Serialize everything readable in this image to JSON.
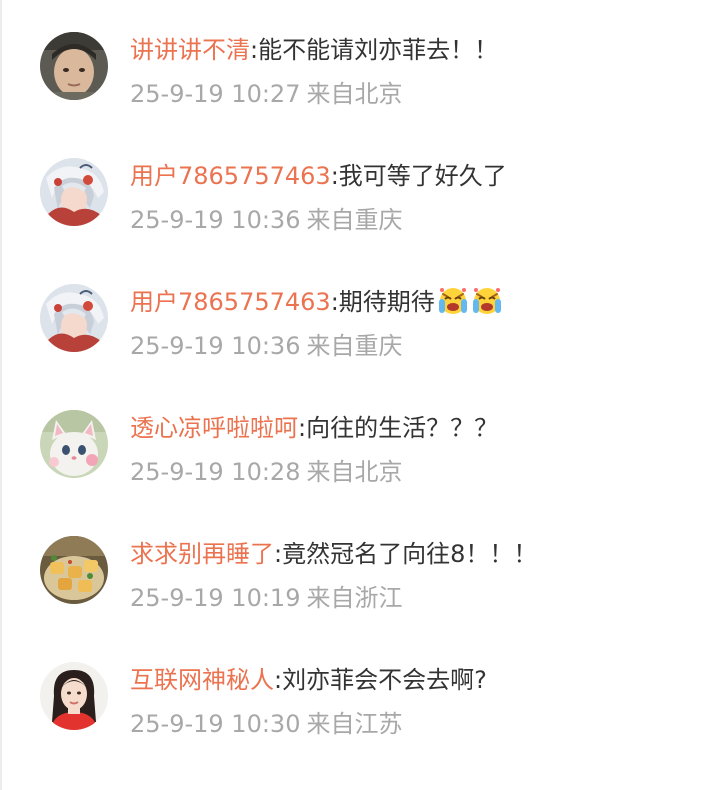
{
  "comments": [
    {
      "username": "讲讲讲不清",
      "separator": ":",
      "text": "能不能请刘亦菲去！！",
      "time": "25-9-19 10:27",
      "location": "来自北京",
      "avatar": "child-photo-avatar"
    },
    {
      "username": "用户7865757463",
      "separator": ":",
      "text": "我可等了好久了",
      "time": "25-9-19 10:36",
      "location": "来自重庆",
      "avatar": "anime-girl-avatar"
    },
    {
      "username": "用户7865757463",
      "separator": ":",
      "text": "期待期待",
      "time": "25-9-19 10:36",
      "location": "来自重庆",
      "avatar": "anime-girl-avatar",
      "emojis": [
        "crying-face-emoji",
        "crying-face-emoji"
      ]
    },
    {
      "username": "透心凉呼啦啦呵",
      "separator": ":",
      "text": "向往的生活？？？",
      "time": "25-9-19 10:28",
      "location": "来自北京",
      "avatar": "cat-avatar"
    },
    {
      "username": "求求别再睡了",
      "separator": ":",
      "text": "竟然冠名了向往8！！！",
      "time": "25-9-19 10:19",
      "location": "来自浙江",
      "avatar": "food-avatar"
    },
    {
      "username": "互联网神秘人",
      "separator": ":",
      "text": "刘亦菲会不会去啊?",
      "time": "25-9-19 10:30",
      "location": "来自江苏",
      "avatar": "woman-portrait-avatar"
    }
  ],
  "colors": {
    "username": "#eb7350",
    "text": "#333333",
    "meta": "#a8a8a8"
  }
}
